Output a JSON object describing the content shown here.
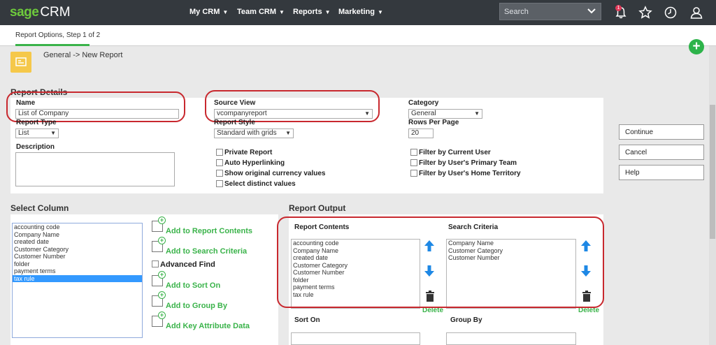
{
  "app": {
    "logo_brand": "sage",
    "logo_product": "CRM"
  },
  "nav": {
    "my_crm": "My CRM",
    "team_crm": "Team CRM",
    "reports": "Reports",
    "marketing": "Marketing"
  },
  "search": {
    "placeholder": "Search"
  },
  "notifications": {
    "count": "1"
  },
  "tabs": {
    "step": "Report Options, Step 1 of 2"
  },
  "breadcrumb": "General -> New Report",
  "report_details": {
    "title": "Report Details",
    "name_label": "Name",
    "name_value": "List of Company",
    "source_view_label": "Source View",
    "source_view_value": "vcompanyreport",
    "category_label": "Category",
    "category_value": "General",
    "report_type_label": "Report Type",
    "report_type_value": "List",
    "report_style_label": "Report Style",
    "report_style_value": "Standard with grids",
    "rows_per_page_label": "Rows Per Page",
    "rows_per_page_value": "20",
    "description_label": "Description",
    "options_left": [
      "Private Report",
      "Auto Hyperlinking",
      "Show original currency values",
      "Select distinct values"
    ],
    "options_right": [
      "Filter by Current User",
      "Filter by User's Primary Team",
      "Filter by User's Home Territory"
    ]
  },
  "actions": {
    "continue": "Continue",
    "cancel": "Cancel",
    "help": "Help"
  },
  "select_column": {
    "title": "Select Column",
    "items": [
      "accounting code",
      "Company Name",
      "created date",
      "Customer Category",
      "Customer Number",
      "folder",
      "payment terms",
      "tax rule"
    ],
    "selected_index": 7,
    "links": [
      "Add to Report Contents",
      "Add to Search Criteria",
      "Advanced Find",
      "Add to Sort On",
      "Add to Group By",
      "Add Key Attribute Data"
    ]
  },
  "report_output": {
    "title": "Report Output",
    "report_contents_label": "Report Contents",
    "report_contents": [
      "accounting code",
      "Company Name",
      "created date",
      "Customer Category",
      "Customer Number",
      "folder",
      "payment terms",
      "tax rule"
    ],
    "search_criteria_label": "Search Criteria",
    "search_criteria": [
      "Company Name",
      "Customer Category",
      "Customer Number"
    ],
    "delete_label": "Delete",
    "sort_on_label": "Sort On",
    "group_by_label": "Group By"
  }
}
